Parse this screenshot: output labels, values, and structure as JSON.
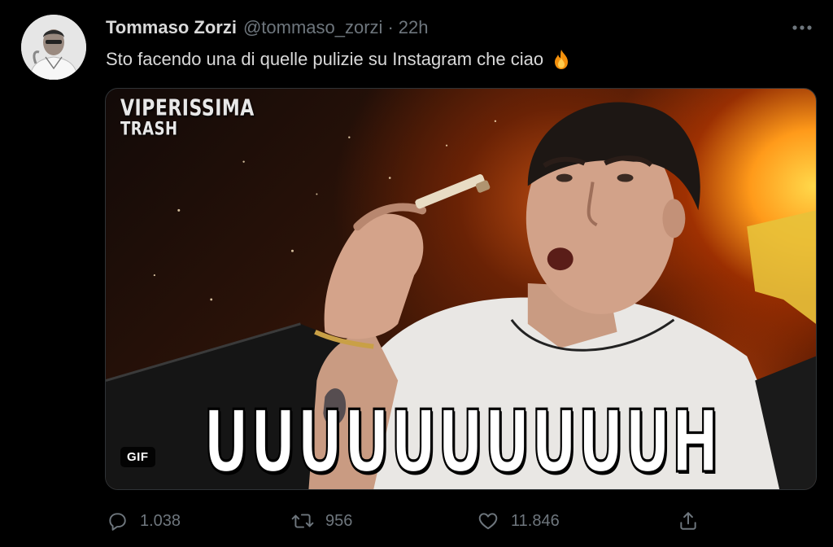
{
  "author": {
    "display_name": "Tommaso Zorzi",
    "handle": "@tommaso_zorzi",
    "separator": "·",
    "time": "22h"
  },
  "tweet": {
    "text": "Sto facendo una di quelle pulizie su Instagram che ciao",
    "emoji_icon": "fire-icon"
  },
  "media": {
    "watermark_line1": "VIPERISSIMA",
    "watermark_line2": "TRASH",
    "caption": "UUUUUUUUUUH",
    "badge": "GIF"
  },
  "actions": {
    "reply_count": "1.038",
    "retweet_count": "956",
    "like_count": "11.846",
    "icons": [
      "reply-icon",
      "retweet-icon",
      "like-icon",
      "share-icon"
    ]
  },
  "colors": {
    "background": "#000000",
    "primary_text": "#d9d9d9",
    "secondary_text": "#6e767d",
    "border": "#2f3336"
  }
}
